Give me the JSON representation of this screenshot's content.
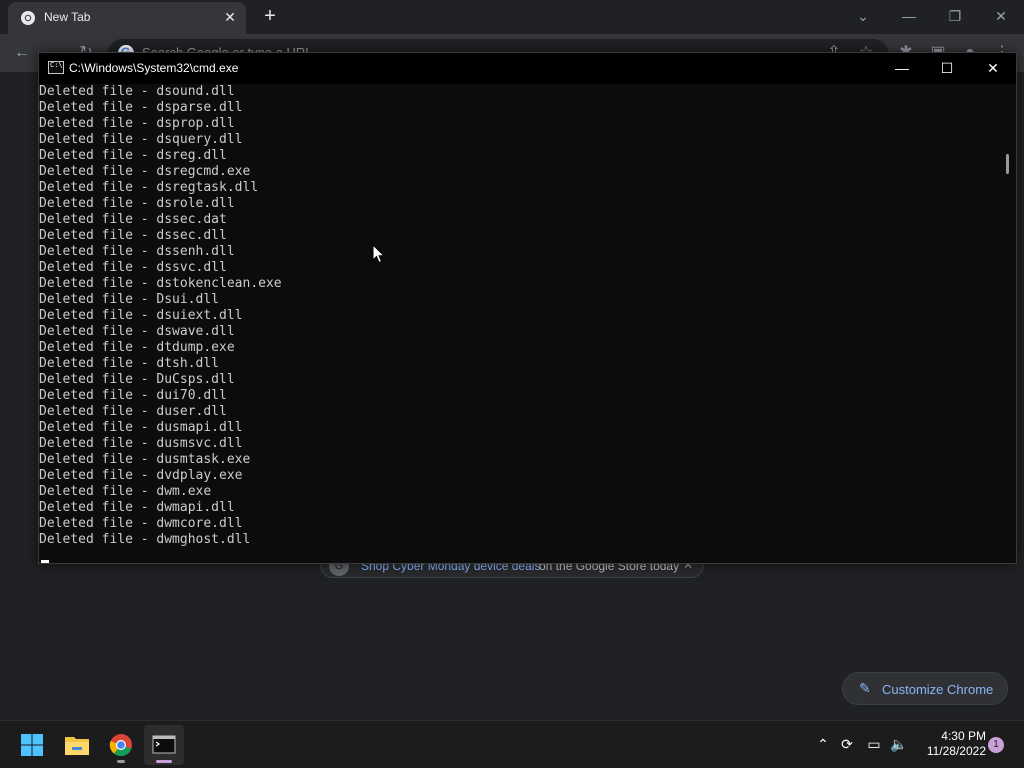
{
  "chrome": {
    "tab_title": "New Tab",
    "tab_close": "✕",
    "new_tab": "+",
    "omnibox_placeholder": "Search Google or type a URL",
    "promo_link": "Shop Cyber Monday device deals",
    "promo_rest": "on the Google Store today",
    "promo_close": "✕",
    "customize_label": "Customize Chrome"
  },
  "cmd": {
    "title": "C:\\Windows\\System32\\cmd.exe",
    "minimize": "—",
    "maximize": "☐",
    "close": "✕",
    "lines": [
      "Deleted file - dsound.dll",
      "Deleted file - dsparse.dll",
      "Deleted file - dsprop.dll",
      "Deleted file - dsquery.dll",
      "Deleted file - dsreg.dll",
      "Deleted file - dsregcmd.exe",
      "Deleted file - dsregtask.dll",
      "Deleted file - dsrole.dll",
      "Deleted file - dssec.dat",
      "Deleted file - dssec.dll",
      "Deleted file - dssenh.dll",
      "Deleted file - dssvc.dll",
      "Deleted file - dstokenclean.exe",
      "Deleted file - Dsui.dll",
      "Deleted file - dsuiext.dll",
      "Deleted file - dswave.dll",
      "Deleted file - dtdump.exe",
      "Deleted file - dtsh.dll",
      "Deleted file - DuCsps.dll",
      "Deleted file - dui70.dll",
      "Deleted file - duser.dll",
      "Deleted file - dusmapi.dll",
      "Deleted file - dusmsvc.dll",
      "Deleted file - dusmtask.exe",
      "Deleted file - dvdplay.exe",
      "Deleted file - dwm.exe",
      "Deleted file - dwmapi.dll",
      "Deleted file - dwmcore.dll",
      "Deleted file - dwmghost.dll"
    ]
  },
  "taskbar": {
    "time": "4:30 PM",
    "date": "11/28/2022",
    "notification_count": "1"
  }
}
